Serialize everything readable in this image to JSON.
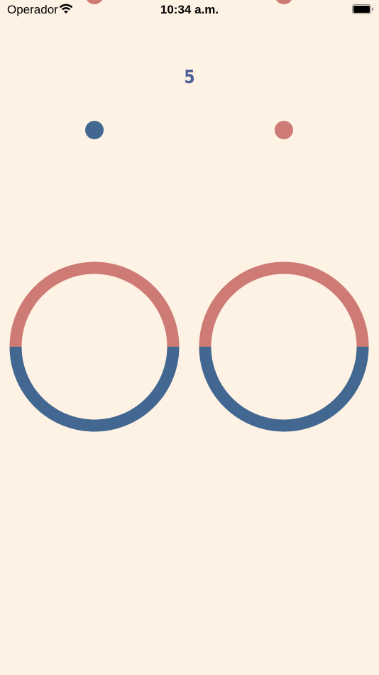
{
  "status_bar": {
    "carrier": "Operador",
    "time": "10:34 a.m.",
    "icons": [
      "wifi-icon",
      "battery-icon"
    ]
  },
  "game": {
    "score": "5",
    "colors": {
      "background": "#FEF2E4",
      "red": "#CD7B74",
      "blue": "#426791",
      "score_text": "#4F5F9E"
    },
    "balls": [
      {
        "name": "left-ball",
        "color": "blue"
      },
      {
        "name": "right-ball",
        "color": "red"
      },
      {
        "name": "left-incoming-ball",
        "color": "red"
      },
      {
        "name": "right-incoming-ball",
        "color": "red"
      }
    ],
    "rings": [
      {
        "name": "left-ring",
        "top_color": "red",
        "bottom_color": "blue"
      },
      {
        "name": "right-ring",
        "top_color": "red",
        "bottom_color": "blue"
      }
    ]
  }
}
